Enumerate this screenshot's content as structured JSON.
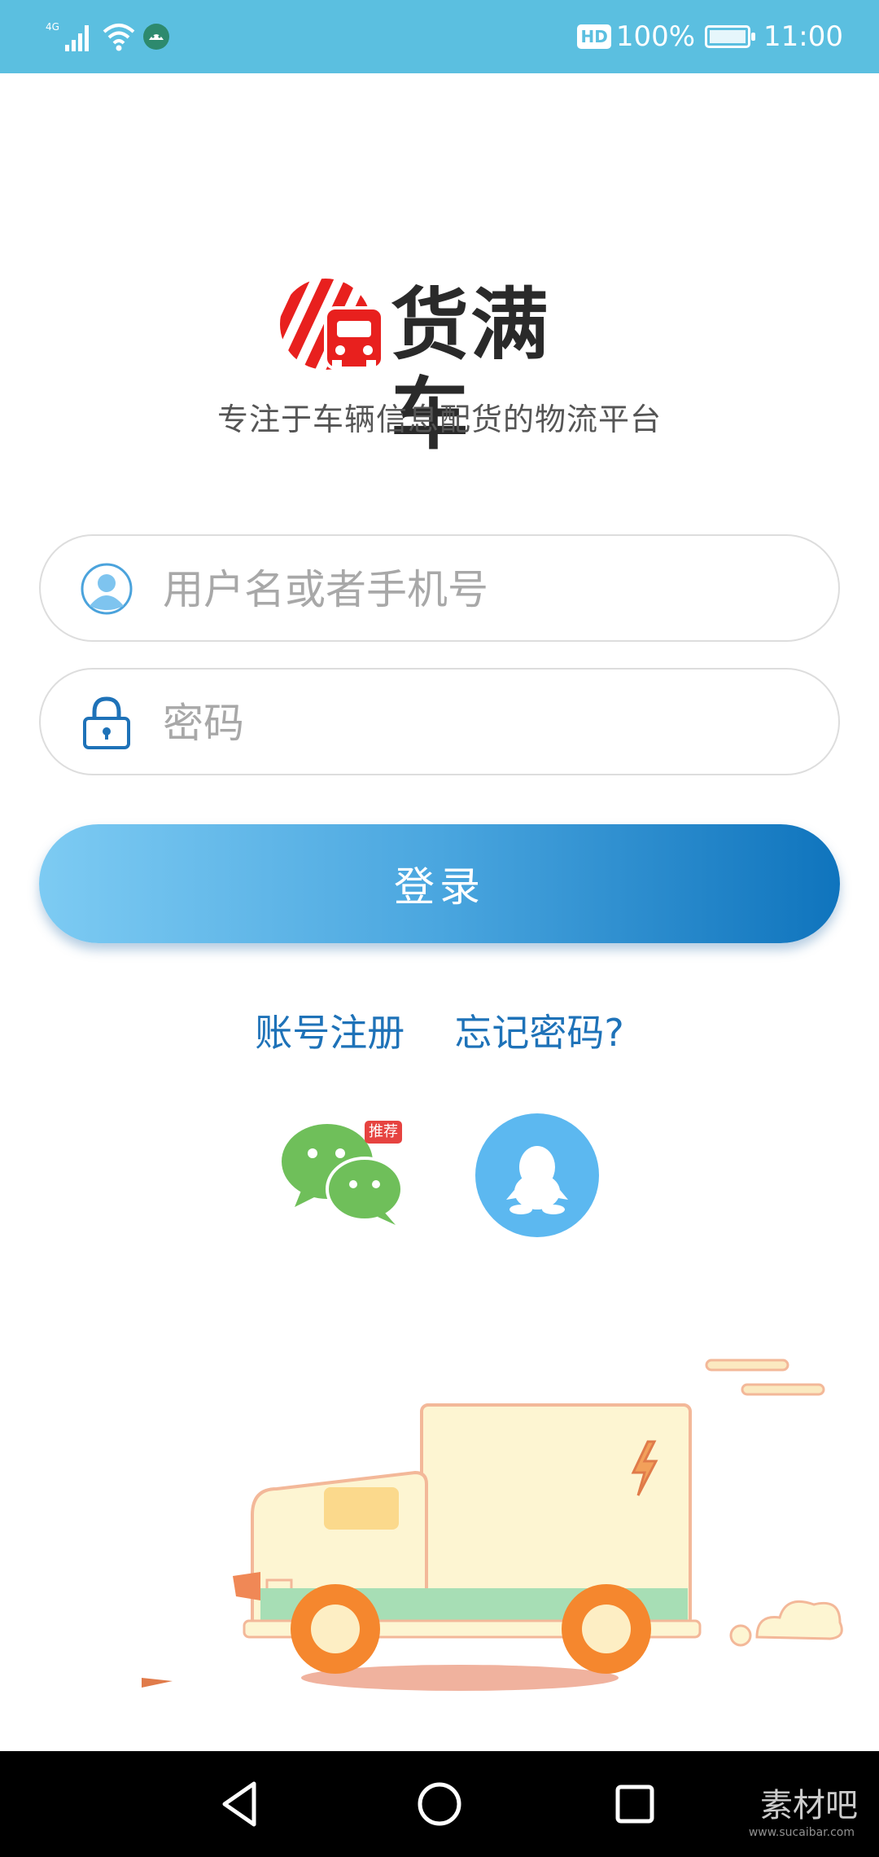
{
  "status_bar": {
    "network": "4G",
    "hd_badge": "HD",
    "battery_percent": "100%",
    "battery_level": 1.0,
    "time": "11:00"
  },
  "brand": {
    "name": "货满车",
    "slogan": "专注于车辆信息配货的物流平台",
    "logo_color": "#e8201e"
  },
  "login_form": {
    "username_placeholder": "用户名或者手机号",
    "password_placeholder": "密码",
    "login_label": "登录"
  },
  "links": {
    "register": "账号注册",
    "forgot_password": "忘记密码?"
  },
  "social": {
    "wechat_badge": "推荐",
    "wechat_color": "#6fbf5a",
    "qq_color": "#5cb8f0"
  },
  "watermark": {
    "text": "素材吧",
    "sub": "www.sucaibar.com"
  },
  "colors": {
    "status_bar": "#5bbfe0",
    "accent_link": "#1e72b8",
    "button_gradient_start": "#7dcbf3",
    "button_gradient_end": "#0f74bd"
  }
}
